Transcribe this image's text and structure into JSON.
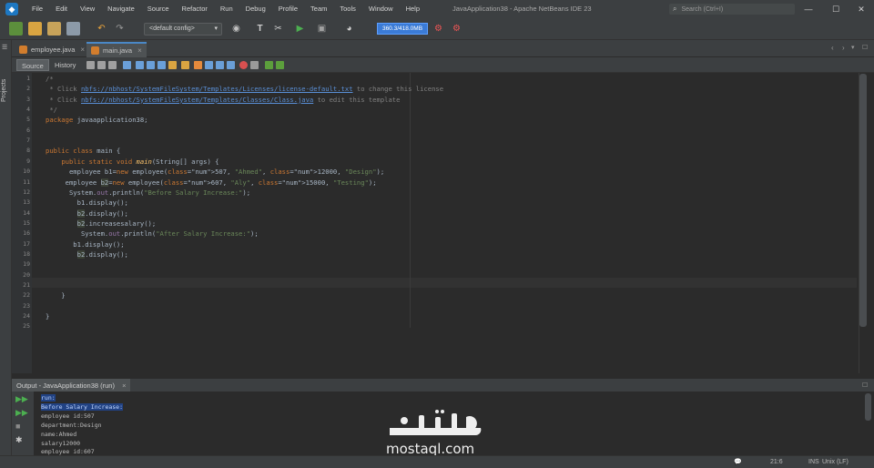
{
  "window": {
    "title": "JavaApplication38 - Apache NetBeans IDE 23",
    "search_placeholder": "Search (Ctrl+I)"
  },
  "menu": [
    "File",
    "Edit",
    "View",
    "Navigate",
    "Source",
    "Refactor",
    "Run",
    "Debug",
    "Profile",
    "Team",
    "Tools",
    "Window",
    "Help"
  ],
  "toolbar": {
    "config": "<default config>",
    "memory": "360.3/418.0MB"
  },
  "side_panel": {
    "projects_label": "Projects"
  },
  "tabs": [
    {
      "label": "employee.java",
      "active": false
    },
    {
      "label": "main.java",
      "active": true
    }
  ],
  "editor_toolbar": {
    "source": "Source",
    "history": "History"
  },
  "editor": {
    "line_numbers": [
      "1",
      "2",
      "3",
      "4",
      "5",
      "6",
      "7",
      "8",
      "9",
      "10",
      "11",
      "12",
      "13",
      "14",
      "15",
      "16",
      "17",
      "18",
      "19",
      "20",
      "21",
      "22",
      "23",
      "24",
      "25"
    ],
    "lines": [
      "/*",
      " * Click nbfs://nbhost/SystemFileSystem/Templates/Licenses/license-default.txt to change this license",
      " * Click nbfs://nbhost/SystemFileSystem/Templates/Classes/Class.java to edit this template",
      " */",
      "package javaapplication38;",
      "",
      "",
      "public class main {",
      "    public static void main(String[] args) {",
      "      employee b1=new employee(507, \"Ahmed\", 12000, \"Design\");",
      "     employee b2=new employee(607, \"Aly\", 15000, \"Testing\");",
      "      System.out.println(\"Before Salary Increase:\");",
      "        b1.display();",
      "        b2.display();",
      "        b2.increasesalary();",
      "         System.out.println(\"After Salary Increase:\");",
      "       b1.display();",
      "        b2.display();",
      "",
      "",
      "",
      "    }",
      "",
      "}",
      ""
    ]
  },
  "output": {
    "tab_label": "Output - JavaApplication38 (run)",
    "lines": [
      "run:",
      "Before Salary Increase:",
      "employee id:507",
      "department:Design",
      "name:Ahmed",
      "salary12000",
      "employee id:607"
    ]
  },
  "status": {
    "position": "21:6",
    "mode": "INS",
    "line_ending": "Unix (LF)"
  },
  "watermark": {
    "arabic": "مستقل",
    "latin": "mostaql.com"
  },
  "colors": {
    "keyword": "#cc7832",
    "string": "#6a8759",
    "number": "#6897bb",
    "comment": "#808080",
    "link": "#5a8fd6",
    "selection": "#214283"
  }
}
